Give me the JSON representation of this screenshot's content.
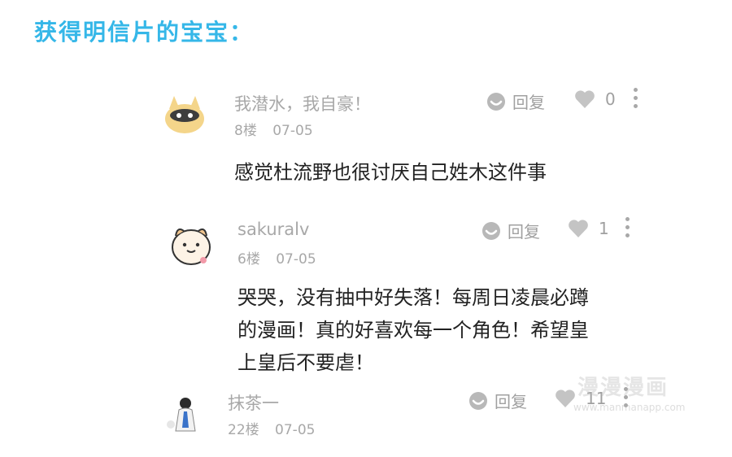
{
  "page": {
    "title": "获得明信片的宝宝："
  },
  "colors": {
    "title": "#35b7e8",
    "muted": "#a8a8a8",
    "text": "#222222"
  },
  "comments": [
    {
      "username": "我潜水，我自豪！",
      "floor": "8楼",
      "date": "07-05",
      "reply_label": "回复",
      "likes": "0",
      "text": "感觉杜流野也很讨厌自己姓木这件事"
    },
    {
      "username": "sakuralv",
      "floor": "6楼",
      "date": "07-05",
      "reply_label": "回复",
      "likes": "1",
      "text_lines": [
        "哭哭，没有抽中好失落！每周日凌晨必蹲",
        "的漫画！真的好喜欢每一个角色！希望皇",
        "上皇后不要虐！"
      ]
    },
    {
      "username": "抹茶一",
      "floor": "22楼",
      "date": "07-05",
      "reply_label": "回复",
      "likes": "11"
    }
  ],
  "watermark": {
    "text": "漫漫漫画",
    "sub": "www.manmanapp.com"
  },
  "icons": {
    "reply": "reply-bubble-icon",
    "like": "heart-icon",
    "more": "more-vertical-icon"
  }
}
